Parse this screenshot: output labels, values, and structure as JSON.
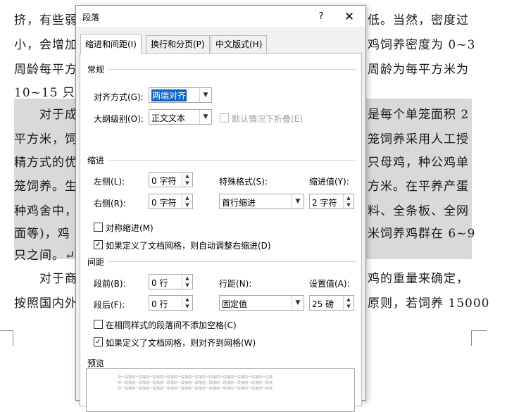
{
  "document": {
    "lines_left": [
      "挤，有些弱",
      "小，会增加",
      "周龄每平方",
      "10~15 只。",
      "对于成",
      "平方米，饲",
      "精方式的优",
      "笼饲养。生",
      "种鸡舍中，",
      "面等)，鸡",
      "只之间。↵",
      "对于商",
      "按照国内外"
    ],
    "lines_right": [
      "低。当然，密度过",
      "鸡饲养密度为 0~3",
      "周龄为每平方米为",
      "",
      "是每个单笼面积 2",
      "笼饲养采用人工授",
      "只母鸡，种公鸡单",
      "方米。在平养产蛋",
      "料、全条板、全网",
      "米饲养鸡群在 6~9",
      "",
      "鸡的重量来确定，",
      "原则，若饲养 15000"
    ]
  },
  "dialog": {
    "title": "段落",
    "help": "?",
    "close": "✕",
    "tabs": [
      "缩进和间距(I)",
      "换行和分页(P)",
      "中文版式(H)"
    ],
    "general": {
      "heading": "常规",
      "alignment_label": "对齐方式(G):",
      "alignment_value": "两端对齐",
      "outline_label": "大纲级别(O):",
      "outline_value": "正文文本",
      "collapse_label": "默认情况下折叠(E)"
    },
    "indent": {
      "heading": "缩进",
      "left_label": "左侧(L):",
      "left_value": "0 字符",
      "right_label": "右侧(R):",
      "right_value": "0 字符",
      "special_label": "特殊格式(S):",
      "special_value": "首行缩进",
      "by_label": "缩进值(Y):",
      "by_value": "2 字符",
      "mirror_label": "对称缩进(M)",
      "auto_adjust_label": "如果定义了文档网格，则自动调整右缩进(D)"
    },
    "spacing": {
      "heading": "间距",
      "before_label": "段前(B):",
      "before_value": "0 行",
      "after_label": "段后(F):",
      "after_value": "0 行",
      "line_label": "行距(N):",
      "line_value": "固定值",
      "at_label": "设置值(A):",
      "at_value": "25 磅",
      "no_space_label": "在相同样式的段落间不添加空格(C)",
      "snap_grid_label": "如果定义了文档网格，则对齐到网格(W)"
    },
    "preview": {
      "heading": "预览",
      "sample": "前一段落前一段落前一段落前一段落前一段落前一段落前一段落前一段落前一段落前一段落前一段落"
    }
  }
}
